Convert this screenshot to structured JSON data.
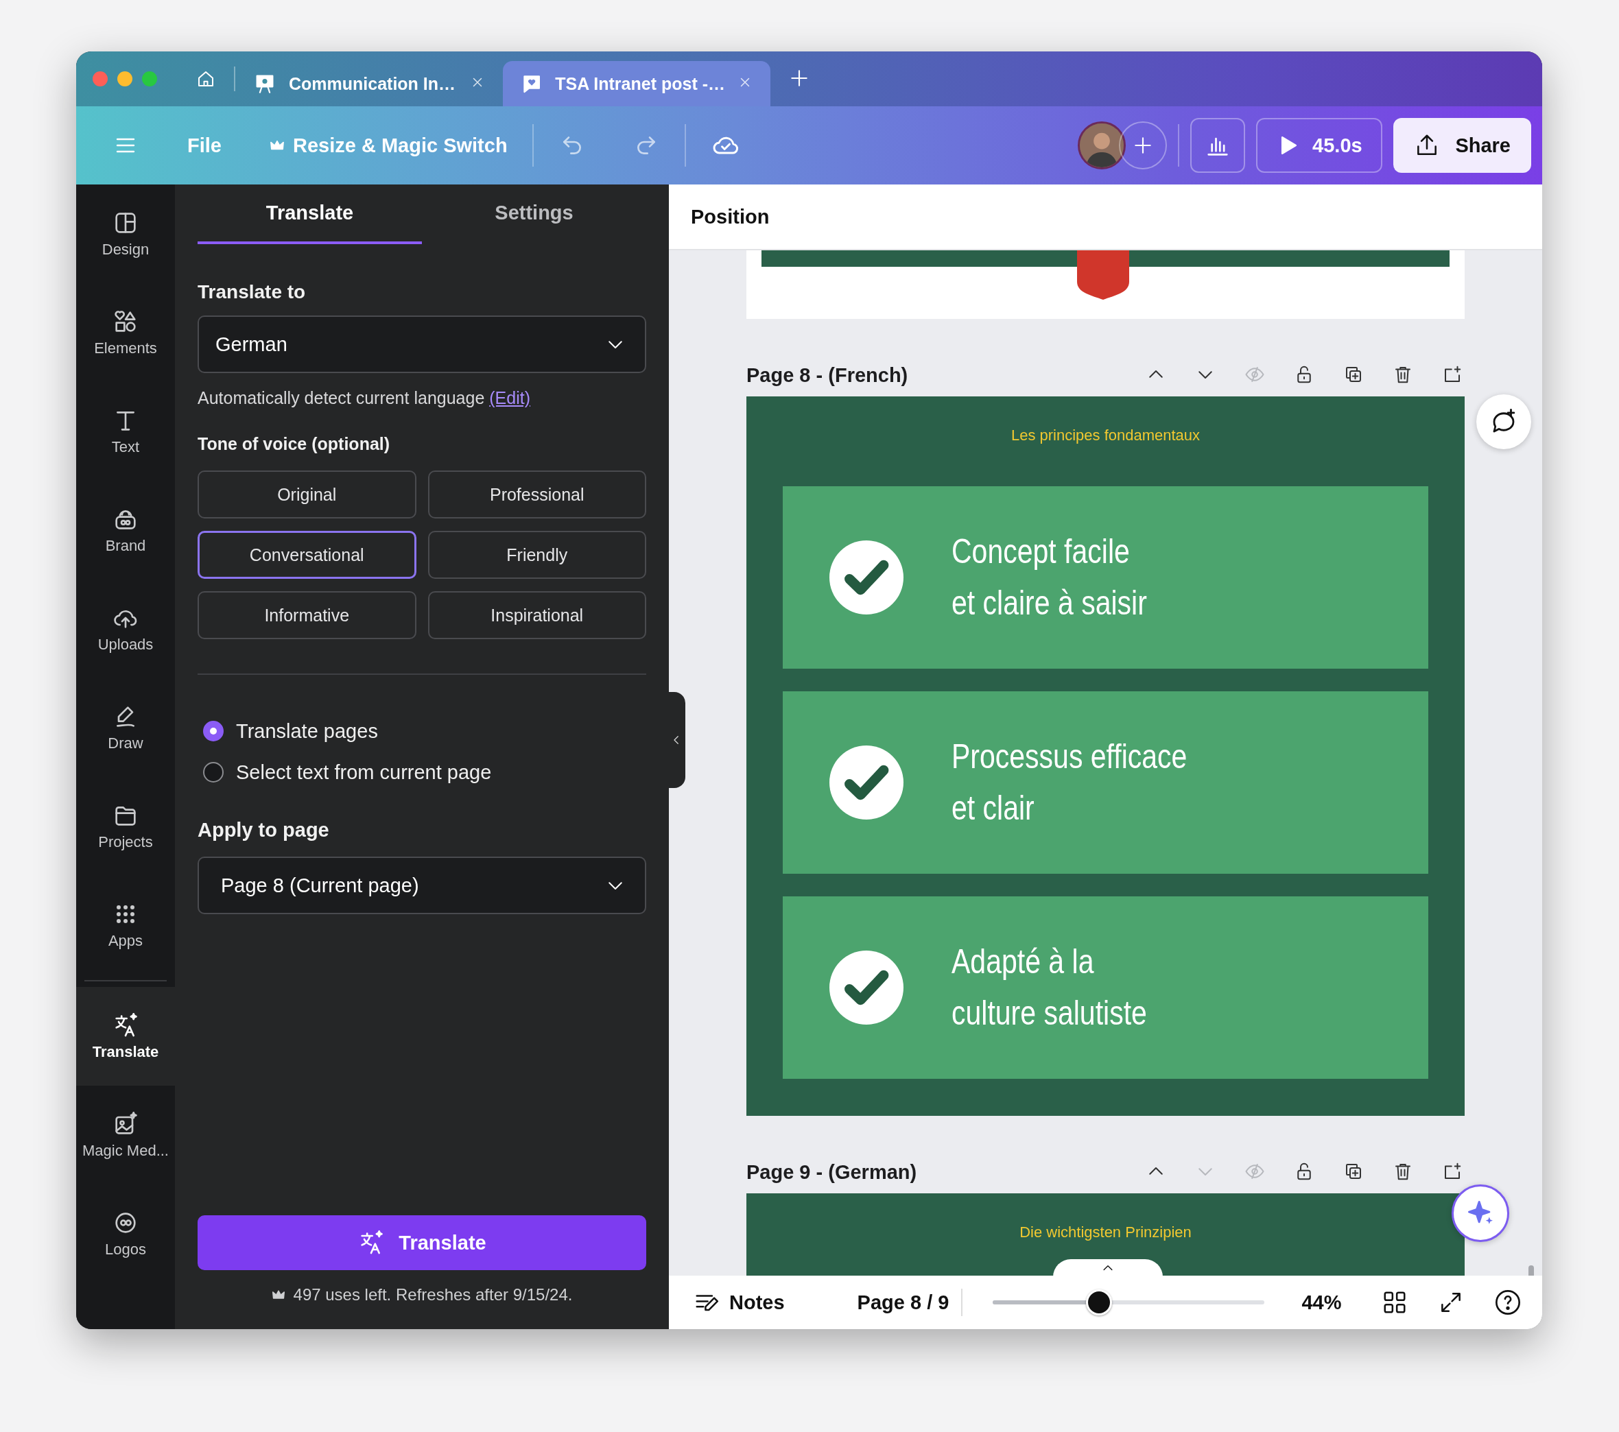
{
  "browser_tabs": [
    {
      "title": "Communication In…",
      "kind": "presentation",
      "selected": false
    },
    {
      "title": "TSA Intranet post -…",
      "kind": "heart",
      "selected": true
    }
  ],
  "toolbar": {
    "file": "File",
    "resize": "Resize & Magic Switch",
    "timer": "45.0s",
    "share": "Share"
  },
  "rail": [
    {
      "label": "Design",
      "kind": "design",
      "selected": false
    },
    {
      "label": "Elements",
      "kind": "elements",
      "selected": false
    },
    {
      "label": "Text",
      "kind": "text",
      "selected": false
    },
    {
      "label": "Brand",
      "kind": "brand",
      "selected": false
    },
    {
      "label": "Uploads",
      "kind": "uploads",
      "selected": false
    },
    {
      "label": "Draw",
      "kind": "draw",
      "selected": false
    },
    {
      "label": "Projects",
      "kind": "projects",
      "selected": false
    },
    {
      "label": "Apps",
      "kind": "apps",
      "selected": false
    },
    {
      "label": "Translate",
      "kind": "translate",
      "selected": true
    },
    {
      "label": "Magic Med...",
      "kind": "magic",
      "selected": false
    },
    {
      "label": "Logos",
      "kind": "logos",
      "selected": false
    }
  ],
  "panel": {
    "tabs": [
      {
        "label": "Translate",
        "selected": true
      },
      {
        "label": "Settings",
        "selected": false
      }
    ],
    "translate_to": "Translate to",
    "language": "German",
    "detect_text": "Automatically detect current language",
    "edit_link": "(Edit)",
    "tone_label": "Tone of voice (optional)",
    "tones": [
      {
        "label": "Original",
        "selected": false
      },
      {
        "label": "Professional",
        "selected": false
      },
      {
        "label": "Conversational",
        "selected": true
      },
      {
        "label": "Friendly",
        "selected": false
      },
      {
        "label": "Informative",
        "selected": false
      },
      {
        "label": "Inspirational",
        "selected": false
      }
    ],
    "options": [
      {
        "label": "Translate pages",
        "selected": true
      },
      {
        "label": "Select text from current page",
        "selected": false
      }
    ],
    "apply_label": "Apply to page",
    "page_select": "Page 8 (Current page)",
    "translate_button": "Translate",
    "uses": "497 uses left. Refreshes after 9/15/24."
  },
  "canvas": {
    "header": "Position",
    "pages": [
      {
        "title": "Page 8 - (French)",
        "down_disabled": false,
        "heading": "Les principes fondamentaux",
        "items": [
          "Concept facile\net claire à saisir",
          "Processus efficace\net clair",
          "Adapté à la\nculture salutiste"
        ]
      },
      {
        "title": "Page 9 - (German)",
        "down_disabled": true,
        "heading": "Die wichtigsten Prinzipien"
      }
    ]
  },
  "bottom_bar": {
    "notes": "Notes",
    "page": "Page 8 / 9",
    "zoom": {
      "level": 0.39
    },
    "zoom_text": "44%"
  }
}
